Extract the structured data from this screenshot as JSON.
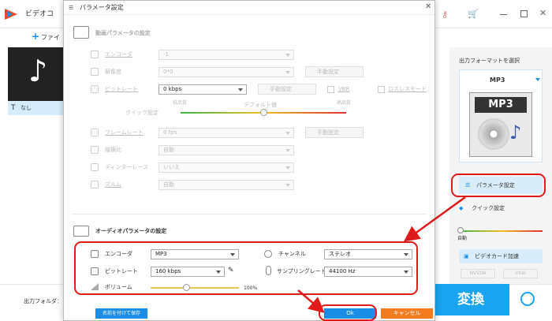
{
  "app": {
    "title": "ビデオコ",
    "file_label": "ファイ",
    "list_item": "なし",
    "output_folder": "出力フォルダ：",
    "convert": "変換"
  },
  "dialog": {
    "title": "パラメータ設定",
    "video": {
      "heading": "動画パラメータの設定",
      "encoder_label": "エンコーダ",
      "encoder_value": "-1",
      "resolution_label": "解像度",
      "resolution_value": "0*0",
      "manual": "手動設定",
      "bitrate_label": "ビットレート",
      "bitrate_value": "0 kbps",
      "vbr": "VBR",
      "lossless": "ロスレスモード",
      "quick_label": "クイック設定",
      "low": "低品質",
      "default": "デフォルト値",
      "high": "高品質",
      "framerate_label": "フレームレート",
      "framerate_value": "0 fps",
      "aspect_label": "縦横比",
      "aspect_value": "自動",
      "deinterlace_label": "ディンターレース",
      "deinterlace_value": "いいえ",
      "zoom_label": "ズルム",
      "zoom_value": "自動"
    },
    "audio": {
      "heading": "オーディオパラメータの設定",
      "encoder_label": "エンコーダ",
      "encoder_value": "MP3",
      "channel_label": "チャンネル",
      "channel_value": "ステレオ",
      "bitrate_label": "ビットレート",
      "bitrate_value": "160 kbps",
      "samplerate_label": "サンプリングレート",
      "samplerate_value": "44100 Hz",
      "volume_label": "ボリューム",
      "volume_value": "100%",
      "volume_level": 0.4
    },
    "save_as": "名前を付けて保存",
    "ok": "Ok",
    "cancel": "キャンセル"
  },
  "right": {
    "select_format": "出力フォーマットを選択",
    "format": "MP3",
    "format_icon_text": "MP3",
    "param_settings": "パラメータ設定",
    "quick_settings": "クイック設定",
    "auto": "自動",
    "gpu": "ビデオカード加速",
    "nvidia": "NVIDIA",
    "intel": "Intel"
  },
  "colors": {
    "accent": "#1a8ee6",
    "red": "#e0191b",
    "ok": "#1a8ee6",
    "cancel": "#f47b20",
    "convert_bg": "#1aa3f0"
  }
}
